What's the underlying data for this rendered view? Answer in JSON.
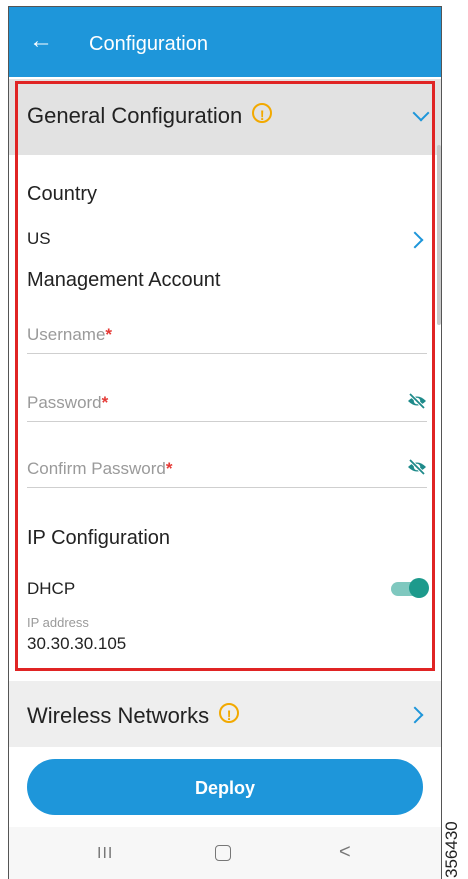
{
  "appbar": {
    "title": "Configuration"
  },
  "general": {
    "title": "General Configuration",
    "country_label": "Country",
    "country_value": "US",
    "mgmt_label": "Management Account",
    "username_placeholder": "Username",
    "password_placeholder": "Password",
    "confirm_placeholder": "Confirm Password",
    "required_mark": "*",
    "ip_config_label": "IP Configuration",
    "dhcp_label": "DHCP",
    "dhcp_enabled": true,
    "ip_address_label": "IP address",
    "ip_address_value": "30.30.30.105"
  },
  "wireless": {
    "title": "Wireless Networks"
  },
  "deploy_label": "Deploy",
  "navbar": {
    "recent": "III",
    "back": "<"
  },
  "figure_id": "356430",
  "colors": {
    "accent": "#1e96da",
    "warning": "#f2a900",
    "required": "#e53935",
    "toggle": "#1d9a8c",
    "highlight_box": "#e02424"
  },
  "icons": [
    "back-arrow-icon",
    "warning-icon",
    "chevron-down-icon",
    "chevron-right-icon",
    "eye-off-icon"
  ]
}
